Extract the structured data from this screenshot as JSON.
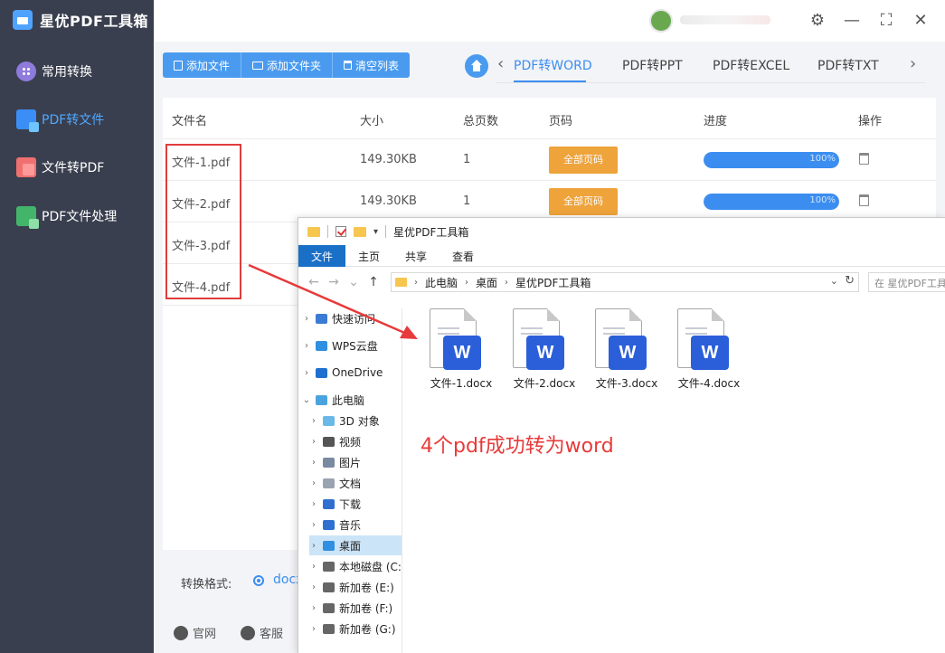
{
  "app": {
    "title": "星优PDF工具箱"
  },
  "sidebar": {
    "items": [
      {
        "label": "常用转换",
        "icon": "grid-icon"
      },
      {
        "label": "PDF转文件",
        "icon": "pdf-convert-icon",
        "active": true
      },
      {
        "label": "文件转PDF",
        "icon": "file-to-pdf-icon"
      },
      {
        "label": "PDF文件处理",
        "icon": "pdf-process-icon"
      }
    ]
  },
  "window_controls": {
    "settings": "⚙",
    "minimize": "—",
    "maximize": "⛶",
    "close": "✕"
  },
  "toolbar": {
    "add_file": "添加文件",
    "add_folder": "添加文件夹",
    "clear_list": "清空列表"
  },
  "tabs": {
    "items": [
      "PDF转WORD",
      "PDF转PPT",
      "PDF转EXCEL",
      "PDF转TXT"
    ],
    "active": 0,
    "prev": "‹",
    "next": "›"
  },
  "table": {
    "headers": [
      "文件名",
      "大小",
      "总页数",
      "页码",
      "进度",
      "操作"
    ],
    "rows": [
      {
        "name": "文件-1.pdf",
        "size": "149.30KB",
        "pages": "1",
        "page_btn": "全部页码",
        "progress": 100,
        "progress_text": "100%"
      },
      {
        "name": "文件-2.pdf",
        "size": "149.30KB",
        "pages": "1",
        "page_btn": "全部页码",
        "progress": 100,
        "progress_text": "100%"
      },
      {
        "name": "文件-3.pdf"
      },
      {
        "name": "文件-4.pdf"
      }
    ]
  },
  "bottom": {
    "format_label": "转换格式:",
    "format_value": "docx",
    "website": "官网",
    "support": "客服"
  },
  "explorer": {
    "title": "星优PDF工具箱",
    "ribbon": [
      "文件",
      "主页",
      "共享",
      "查看"
    ],
    "breadcrumb": [
      "此电脑",
      "桌面",
      "星优PDF工具箱"
    ],
    "search_placeholder": "在 星优PDF工具箱",
    "tree": [
      {
        "label": "快速访问",
        "icon": "star-icon",
        "color": "#3a7bd5"
      },
      {
        "label": "WPS云盘",
        "icon": "cloud-icon",
        "color": "#2f8fe0"
      },
      {
        "label": "OneDrive",
        "icon": "onedrive-icon",
        "color": "#1f6fd0"
      },
      {
        "label": "此电脑",
        "icon": "computer-icon",
        "color": "#4aa3df",
        "expanded": true
      },
      {
        "label": "3D 对象",
        "icon": "3d-icon",
        "color": "#6ab8e8"
      },
      {
        "label": "视频",
        "icon": "video-icon",
        "color": "#555"
      },
      {
        "label": "图片",
        "icon": "picture-icon",
        "color": "#7a8aa0"
      },
      {
        "label": "文档",
        "icon": "document-icon",
        "color": "#9aa3b0"
      },
      {
        "label": "下载",
        "icon": "download-icon",
        "color": "#2f6fd0"
      },
      {
        "label": "音乐",
        "icon": "music-icon",
        "color": "#2f6fd0"
      },
      {
        "label": "桌面",
        "icon": "desktop-icon",
        "color": "#2f8fe0",
        "selected": true
      },
      {
        "label": "本地磁盘 (C:",
        "icon": "disk-icon",
        "color": "#666"
      },
      {
        "label": "新加卷 (E:)",
        "icon": "disk-icon",
        "color": "#666"
      },
      {
        "label": "新加卷 (F:)",
        "icon": "disk-icon",
        "color": "#666"
      },
      {
        "label": "新加卷 (G:)",
        "icon": "disk-icon",
        "color": "#666"
      }
    ],
    "files": [
      {
        "name": "文件-1.docx",
        "badge": "W"
      },
      {
        "name": "文件-2.docx",
        "badge": "W"
      },
      {
        "name": "文件-3.docx",
        "badge": "W"
      },
      {
        "name": "文件-4.docx",
        "badge": "W"
      }
    ]
  },
  "annotation": {
    "text": "4个pdf成功转为word",
    "color": "#e83a3a"
  }
}
